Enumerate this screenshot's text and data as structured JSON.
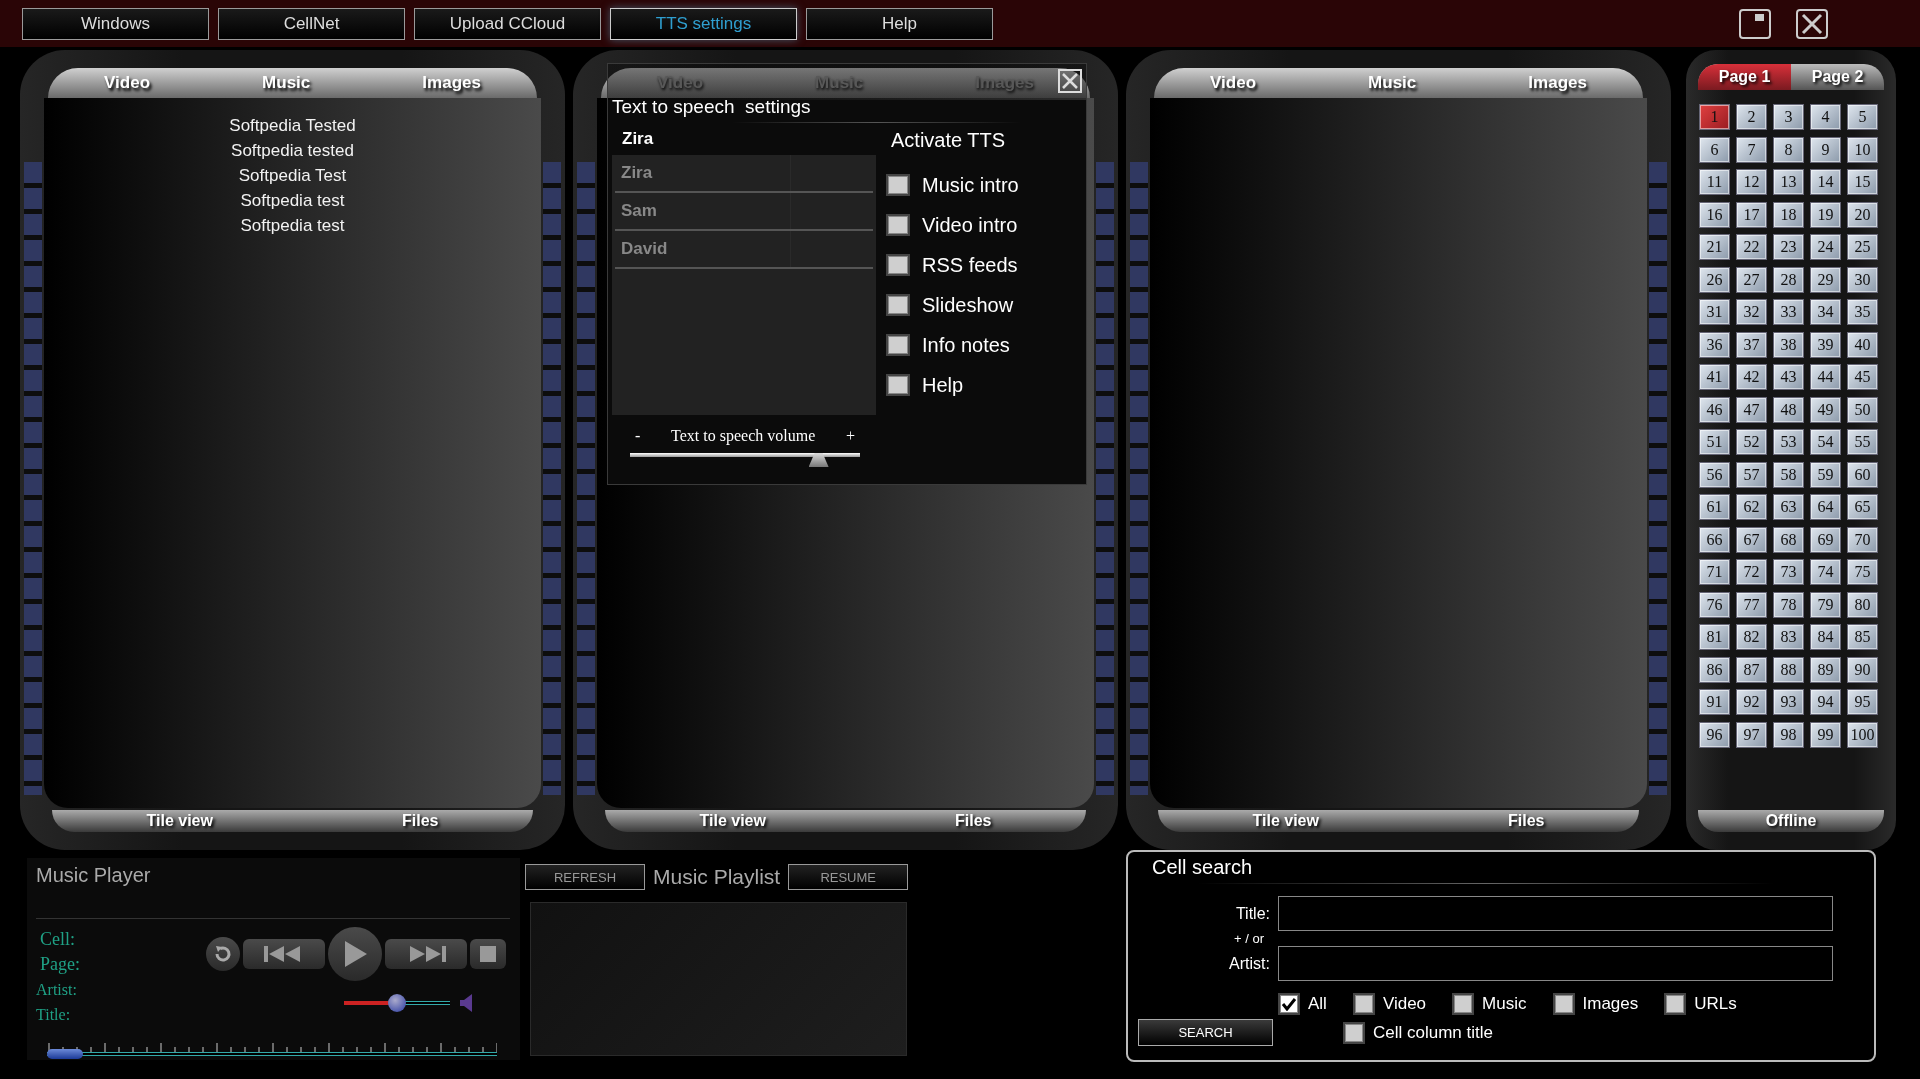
{
  "menu": [
    {
      "label": "Windows",
      "selected": false
    },
    {
      "label": "CellNet",
      "selected": false
    },
    {
      "label": "Upload CCloud",
      "selected": false
    },
    {
      "label": "TTS settings",
      "selected": true
    },
    {
      "label": "Help",
      "selected": false
    }
  ],
  "panels": [
    {
      "tabs": [
        "Video",
        "Music",
        "Images"
      ],
      "items": [
        "Softpedia Tested",
        "Softpedia tested",
        "Softpedia Test",
        "Softpedia test",
        "Softpedia test"
      ],
      "footer": [
        "Tile view",
        "Files"
      ]
    },
    {
      "tabs": [
        "Video",
        "Music",
        "Images"
      ],
      "footer": [
        "Tile view",
        "Files"
      ]
    },
    {
      "tabs": [
        "Video",
        "Music",
        "Images"
      ],
      "footer": [
        "Tile view",
        "Files"
      ]
    }
  ],
  "cell_grid": {
    "pages": [
      {
        "label": "Page 1",
        "selected": true
      },
      {
        "label": "Page 2",
        "selected": false
      }
    ],
    "cells": [
      {
        "label": "1",
        "selected": true
      },
      {
        "label": "2",
        "selected": false
      },
      {
        "label": "3",
        "selected": false
      },
      {
        "label": "4",
        "selected": false
      },
      {
        "label": "5",
        "selected": false
      },
      {
        "label": "6",
        "selected": false
      },
      {
        "label": "7",
        "selected": false
      },
      {
        "label": "8",
        "selected": false
      },
      {
        "label": "9",
        "selected": false
      },
      {
        "label": "10",
        "selected": false
      },
      {
        "label": "11",
        "selected": false
      },
      {
        "label": "12",
        "selected": false
      },
      {
        "label": "13",
        "selected": false
      },
      {
        "label": "14",
        "selected": false
      },
      {
        "label": "15",
        "selected": false
      },
      {
        "label": "16",
        "selected": false
      },
      {
        "label": "17",
        "selected": false
      },
      {
        "label": "18",
        "selected": false
      },
      {
        "label": "19",
        "selected": false
      },
      {
        "label": "20",
        "selected": false
      },
      {
        "label": "21",
        "selected": false
      },
      {
        "label": "22",
        "selected": false
      },
      {
        "label": "23",
        "selected": false
      },
      {
        "label": "24",
        "selected": false
      },
      {
        "label": "25",
        "selected": false
      },
      {
        "label": "26",
        "selected": false
      },
      {
        "label": "27",
        "selected": false
      },
      {
        "label": "28",
        "selected": false
      },
      {
        "label": "29",
        "selected": false
      },
      {
        "label": "30",
        "selected": false
      },
      {
        "label": "31",
        "selected": false
      },
      {
        "label": "32",
        "selected": false
      },
      {
        "label": "33",
        "selected": false
      },
      {
        "label": "34",
        "selected": false
      },
      {
        "label": "35",
        "selected": false
      },
      {
        "label": "36",
        "selected": false
      },
      {
        "label": "37",
        "selected": false
      },
      {
        "label": "38",
        "selected": false
      },
      {
        "label": "39",
        "selected": false
      },
      {
        "label": "40",
        "selected": false
      },
      {
        "label": "41",
        "selected": false
      },
      {
        "label": "42",
        "selected": false
      },
      {
        "label": "43",
        "selected": false
      },
      {
        "label": "44",
        "selected": false
      },
      {
        "label": "45",
        "selected": false
      },
      {
        "label": "46",
        "selected": false
      },
      {
        "label": "47",
        "selected": false
      },
      {
        "label": "48",
        "selected": false
      },
      {
        "label": "49",
        "selected": false
      },
      {
        "label": "50",
        "selected": false
      },
      {
        "label": "51",
        "selected": false
      },
      {
        "label": "52",
        "selected": false
      },
      {
        "label": "53",
        "selected": false
      },
      {
        "label": "54",
        "selected": false
      },
      {
        "label": "55",
        "selected": false
      },
      {
        "label": "56",
        "selected": false
      },
      {
        "label": "57",
        "selected": false
      },
      {
        "label": "58",
        "selected": false
      },
      {
        "label": "59",
        "selected": false
      },
      {
        "label": "60",
        "selected": false
      },
      {
        "label": "61",
        "selected": false
      },
      {
        "label": "62",
        "selected": false
      },
      {
        "label": "63",
        "selected": false
      },
      {
        "label": "64",
        "selected": false
      },
      {
        "label": "65",
        "selected": false
      },
      {
        "label": "66",
        "selected": false
      },
      {
        "label": "67",
        "selected": false
      },
      {
        "label": "68",
        "selected": false
      },
      {
        "label": "69",
        "selected": false
      },
      {
        "label": "70",
        "selected": false
      },
      {
        "label": "71",
        "selected": false
      },
      {
        "label": "72",
        "selected": false
      },
      {
        "label": "73",
        "selected": false
      },
      {
        "label": "74",
        "selected": false
      },
      {
        "label": "75",
        "selected": false
      },
      {
        "label": "76",
        "selected": false
      },
      {
        "label": "77",
        "selected": false
      },
      {
        "label": "78",
        "selected": false
      },
      {
        "label": "79",
        "selected": false
      },
      {
        "label": "80",
        "selected": false
      },
      {
        "label": "81",
        "selected": false
      },
      {
        "label": "82",
        "selected": false
      },
      {
        "label": "83",
        "selected": false
      },
      {
        "label": "84",
        "selected": false
      },
      {
        "label": "85",
        "selected": false
      },
      {
        "label": "86",
        "selected": false
      },
      {
        "label": "87",
        "selected": false
      },
      {
        "label": "88",
        "selected": false
      },
      {
        "label": "89",
        "selected": false
      },
      {
        "label": "90",
        "selected": false
      },
      {
        "label": "91",
        "selected": false
      },
      {
        "label": "92",
        "selected": false
      },
      {
        "label": "93",
        "selected": false
      },
      {
        "label": "94",
        "selected": false
      },
      {
        "label": "95",
        "selected": false
      },
      {
        "label": "96",
        "selected": false
      },
      {
        "label": "97",
        "selected": false
      },
      {
        "label": "98",
        "selected": false
      },
      {
        "label": "99",
        "selected": false
      },
      {
        "label": "100",
        "selected": false
      }
    ],
    "status": "Offline"
  },
  "tts_dialog": {
    "title": "Text to speech  settings",
    "current_voice": "Zira",
    "voices": [
      "Zira",
      "Sam",
      "David"
    ],
    "activate_label": "Activate TTS",
    "options": [
      {
        "label": "Music intro",
        "checked": false
      },
      {
        "label": "Video intro",
        "checked": false
      },
      {
        "label": "RSS feeds",
        "checked": false
      },
      {
        "label": "Slideshow",
        "checked": false
      },
      {
        "label": "Info notes",
        "checked": false
      },
      {
        "label": "Help",
        "checked": false
      }
    ],
    "volume": {
      "minus": "-",
      "label": "Text to speech volume",
      "plus": "+",
      "level": 0.82
    }
  },
  "music_player": {
    "title": "Music Player",
    "fields": [
      "Cell:",
      "Page:",
      "Artist:",
      "Title:"
    ],
    "volume": {
      "level": 0.5
    },
    "progress": {
      "level": 0.04
    }
  },
  "playlist": {
    "refresh": "REFRESH",
    "title": "Music Playlist",
    "resume": "RESUME"
  },
  "cell_search": {
    "title": "Cell search",
    "title_label": "Title:",
    "or_label": "+ / or",
    "artist_label": "Artist:",
    "filters": [
      {
        "label": "All",
        "checked": true
      },
      {
        "label": "Video",
        "checked": false
      },
      {
        "label": "Music",
        "checked": false
      },
      {
        "label": "Images",
        "checked": false
      },
      {
        "label": "URLs",
        "checked": false
      }
    ],
    "column_title": {
      "label": "Cell column title",
      "checked": false
    },
    "search_button": "SEARCH"
  }
}
